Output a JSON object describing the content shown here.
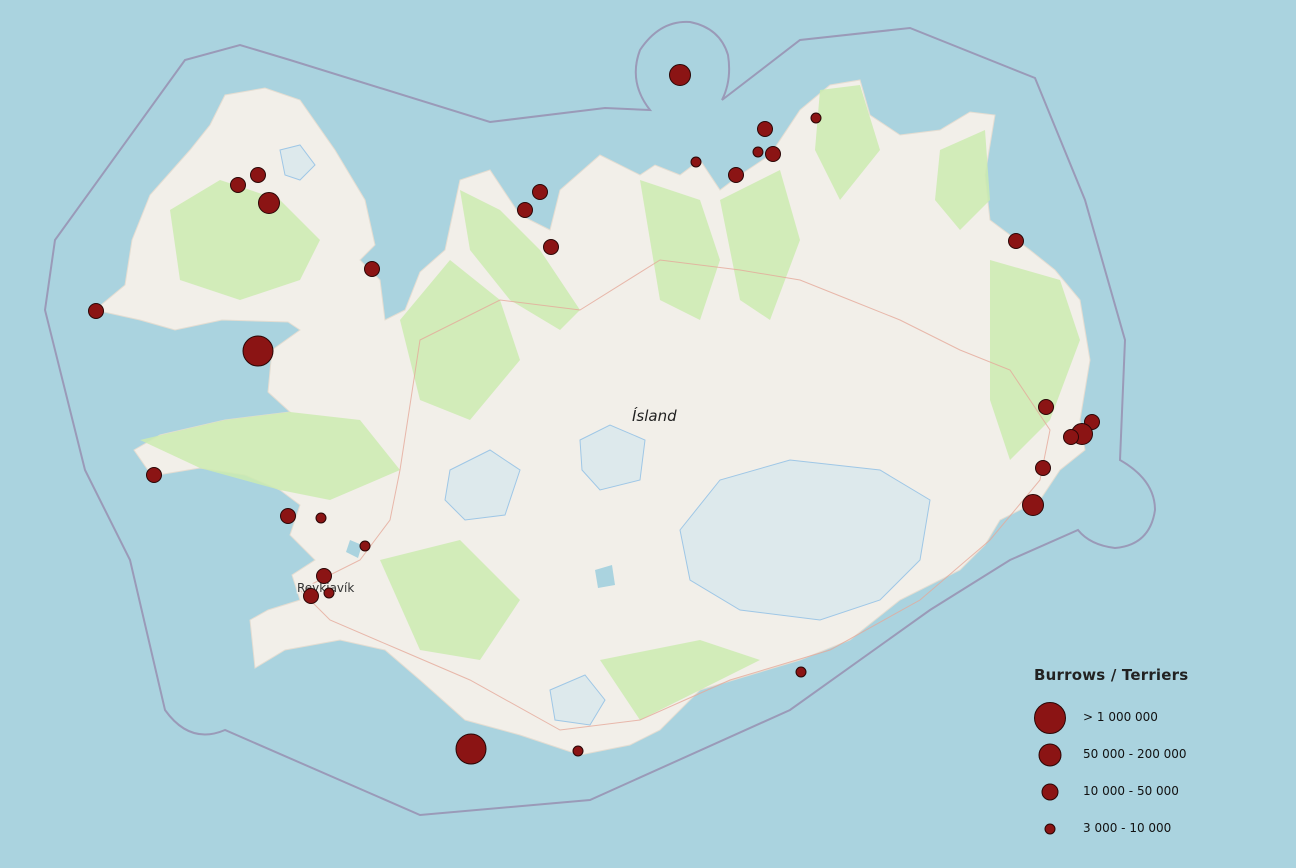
{
  "map": {
    "country_label": "Ísland",
    "city_label": "Reykjavík",
    "colors": {
      "sea": "#aad3df",
      "land": "#f2efe9",
      "vegetation": "#cdebb0",
      "glacier": "#dde9ec",
      "lake": "#aad3df",
      "boundary": "#9a9ab8",
      "marker_fill": "#8b1414",
      "marker_stroke": "#2a0606"
    }
  },
  "legend": {
    "title": "Burrows / Terriers",
    "classes": [
      {
        "label": "> 1 000 000",
        "size_class": 4
      },
      {
        "label": "50 000 - 200 000",
        "size_class": 3
      },
      {
        "label": "10 000 - 50 000",
        "size_class": 2
      },
      {
        "label": "3 000 - 10 000",
        "size_class": 1
      }
    ]
  }
}
